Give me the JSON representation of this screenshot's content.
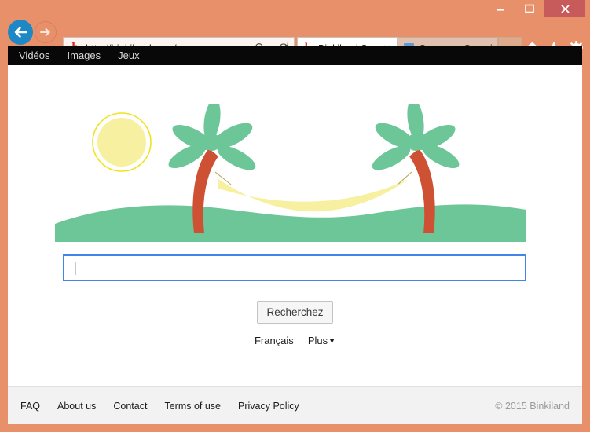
{
  "window": {
    "minimize_label": "–",
    "maximize_label": "☐",
    "close_label": "✕",
    "chrome_color": "#E8906A",
    "close_button_color": "#C75B5B"
  },
  "browser": {
    "back_label": "←",
    "forward_label": "→",
    "address": {
      "favicon": "binkiland-b-icon",
      "url": "http://binkiland.com/",
      "placeholder": "",
      "search_icon": "search-icon",
      "caret_icon": "chevron-down-icon",
      "refresh_icon": "refresh-icon"
    },
    "tabs": [
      {
        "title": "Binkiland Sear...",
        "favicon": "binkiland-b-icon",
        "active": true,
        "close_label": "✕"
      },
      {
        "title": "Comment Suppri...",
        "favicon": "trash-bin-icon",
        "active": false
      }
    ],
    "tools": [
      {
        "name": "home-icon",
        "label": "⌂"
      },
      {
        "name": "favorites-star-icon",
        "label": "★"
      },
      {
        "name": "settings-gear-icon",
        "label": "⚙"
      }
    ]
  },
  "site": {
    "nav": [
      {
        "label": "Vidéos"
      },
      {
        "label": "Images"
      },
      {
        "label": "Jeux"
      }
    ],
    "logo": {
      "alt": "Binkiland beach logo with sun, palm trees, hammock and hill",
      "sun_fill": "#F7F0A0",
      "sun_ring": "#EFE31E",
      "palm_leaf_color": "#6CC698",
      "palm_trunk_color": "#CE5134",
      "hammock_color": "#F7F0A0",
      "hill_color": "#6CC698"
    },
    "search": {
      "value": "",
      "placeholder": "",
      "button_label": "Recherchez",
      "border_color": "#4285E8"
    },
    "language_label": "Français",
    "more_label": "Plus",
    "more_caret": "▼",
    "footer": {
      "links": [
        {
          "label": "FAQ"
        },
        {
          "label": "About us"
        },
        {
          "label": "Contact"
        },
        {
          "label": "Terms of use"
        },
        {
          "label": "Privacy Policy"
        }
      ],
      "copyright": "© 2015 Binkiland"
    }
  }
}
